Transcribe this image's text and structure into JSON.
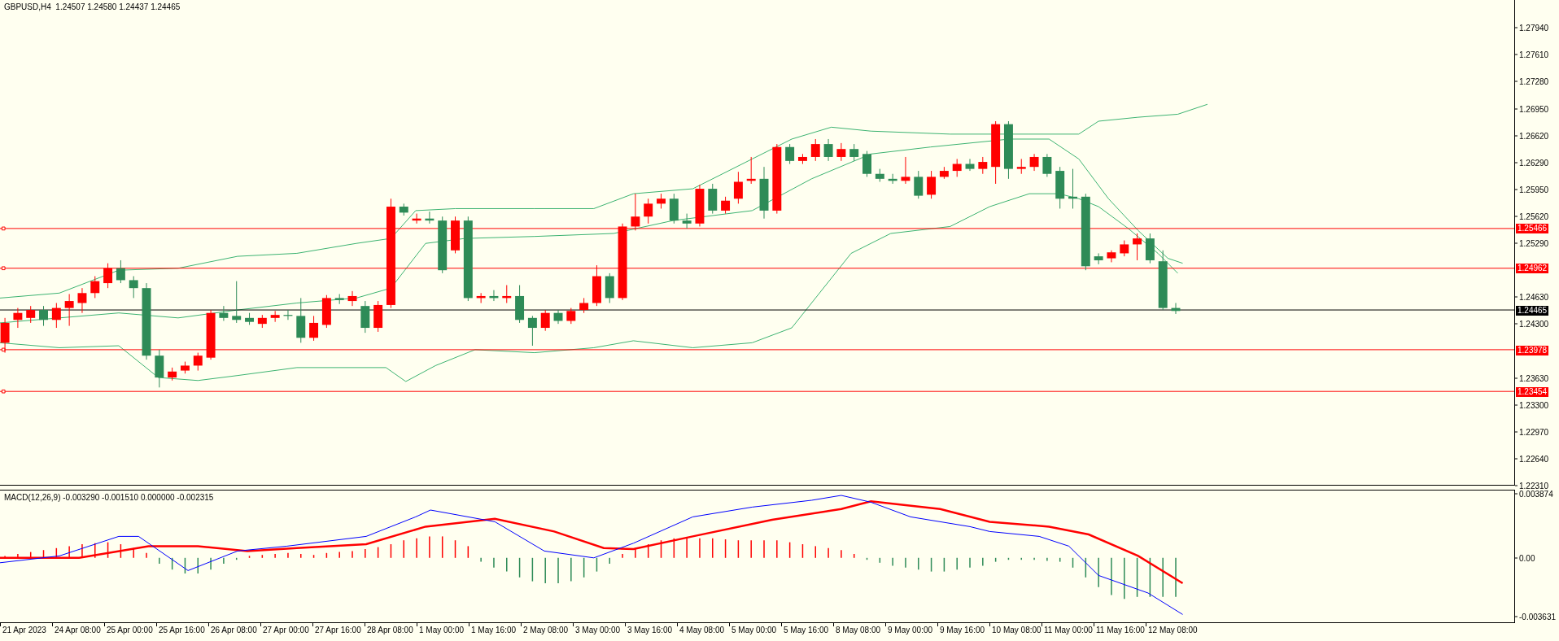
{
  "chart": {
    "header": "GBPUSD,H4  1.24507 1.24580 1.24437 1.24465",
    "price_ticks": [
      "1.27940",
      "1.27610",
      "1.27280",
      "1.26950",
      "1.26620",
      "1.26290",
      "1.25950",
      "1.25620",
      "1.25290",
      "1.24630",
      "1.24300",
      "1.23630",
      "1.23300",
      "1.22970",
      "1.22640",
      "1.22310"
    ],
    "price_lines": [
      {
        "label": "1.25466",
        "kind": "level"
      },
      {
        "label": "1.24962",
        "kind": "level"
      },
      {
        "label": "1.24465",
        "kind": "bid"
      },
      {
        "label": "1.23978",
        "kind": "level"
      },
      {
        "label": "1.23454",
        "kind": "level"
      }
    ]
  },
  "macd": {
    "header": "MACD(12,26,9) -0.003290 -0.001510 0.000000 -0.002315",
    "ticks": [
      "0.003874",
      "0.00",
      "-0.003631"
    ]
  },
  "time_axis": {
    "labels": [
      "21 Apr 2023",
      "24 Apr 08:00",
      "25 Apr 00:00",
      "25 Apr 16:00",
      "26 Apr 08:00",
      "27 Apr 00:00",
      "27 Apr 16:00",
      "28 Apr 08:00",
      "1 May 00:00",
      "1 May 16:00",
      "2 May 08:00",
      "3 May 00:00",
      "3 May 16:00",
      "4 May 08:00",
      "5 May 00:00",
      "5 May 16:00",
      "8 May 08:00",
      "9 May 00:00",
      "9 May 16:00",
      "10 May 08:00",
      "11 May 00:00",
      "11 May 16:00",
      "12 May 08:00"
    ]
  }
}
